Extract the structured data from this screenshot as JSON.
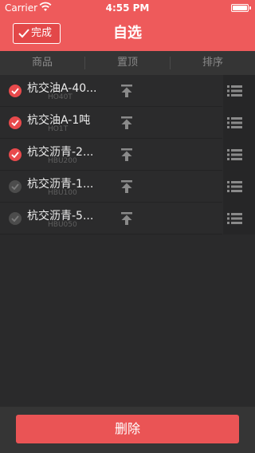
{
  "status": {
    "carrier": "Carrier",
    "time": "4:55 PM",
    "battery_level": 1.0
  },
  "nav": {
    "done_label": "完成",
    "title": "自选"
  },
  "columns": [
    "商品",
    "置顶",
    "排序"
  ],
  "rows": [
    {
      "name": "杭交油A-40...",
      "code": "HO40T",
      "checked": true
    },
    {
      "name": "杭交油A-1吨",
      "code": "HO1T",
      "checked": true
    },
    {
      "name": "杭交沥青-2...",
      "code": "HBU200",
      "checked": true
    },
    {
      "name": "杭交沥青-1...",
      "code": "HBU100",
      "checked": false
    },
    {
      "name": "杭交沥青-5...",
      "code": "HBU050",
      "checked": false
    }
  ],
  "footer": {
    "delete_label": "删除"
  },
  "colors": {
    "accent": "#ee5a5b",
    "checked": "#e84a4c",
    "unchecked": "#4c4c4c"
  },
  "icons": {
    "row_check": "checkmark-circle-icon",
    "pin": "pin-to-top-icon",
    "drag": "reorder-list-icon"
  }
}
